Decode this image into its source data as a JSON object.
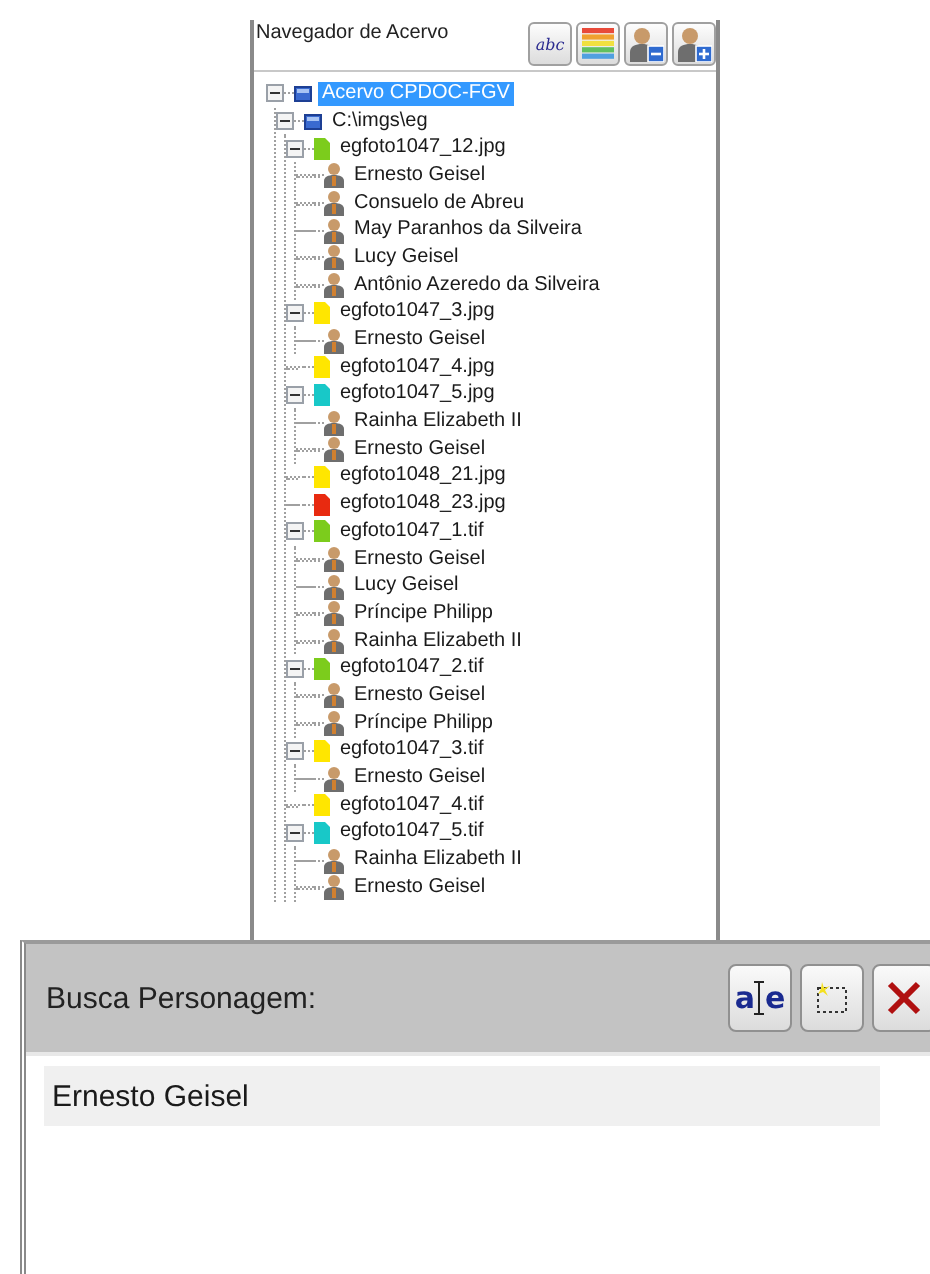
{
  "navigator": {
    "title": "Navegador de Acervo",
    "toolbar": [
      {
        "kind": "text",
        "label": "abc"
      },
      {
        "kind": "stripes"
      },
      {
        "kind": "person-minus"
      },
      {
        "kind": "person-plus"
      }
    ],
    "tree": [
      {
        "kind": "root",
        "label": "Acervo CPDOC-FGV",
        "selected": true,
        "expanded": true,
        "children": [
          {
            "kind": "folder",
            "label": "C:\\imgs\\eg",
            "selected": false,
            "expanded": true,
            "children": [
              {
                "kind": "file",
                "label": "egfoto1047_12.jpg",
                "color": "#7ccc1c",
                "selected": false,
                "expanded": true,
                "children": [
                  {
                    "kind": "person",
                    "label": "Ernesto Geisel",
                    "selected": false
                  },
                  {
                    "kind": "person",
                    "label": "Consuelo de Abreu",
                    "selected": false
                  },
                  {
                    "kind": "person",
                    "label": "May Paranhos da Silveira",
                    "selected": false
                  },
                  {
                    "kind": "person",
                    "label": "Lucy Geisel",
                    "selected": false
                  },
                  {
                    "kind": "person",
                    "label": "Antônio Azeredo da Silveira",
                    "selected": false
                  }
                ]
              },
              {
                "kind": "file",
                "label": "egfoto1047_3.jpg",
                "color": "#ffe600",
                "selected": false,
                "expanded": true,
                "children": [
                  {
                    "kind": "person",
                    "label": "Ernesto Geisel",
                    "selected": false
                  }
                ]
              },
              {
                "kind": "file",
                "label": "egfoto1047_4.jpg",
                "color": "#ffe600",
                "selected": false
              },
              {
                "kind": "file",
                "label": "egfoto1047_5.jpg",
                "color": "#18c8c8",
                "selected": false,
                "expanded": true,
                "children": [
                  {
                    "kind": "person",
                    "label": "Rainha Elizabeth II",
                    "selected": false
                  },
                  {
                    "kind": "person",
                    "label": "Ernesto Geisel",
                    "selected": false
                  }
                ]
              },
              {
                "kind": "file",
                "label": "egfoto1048_21.jpg",
                "color": "#ffe600",
                "selected": false
              },
              {
                "kind": "file",
                "label": "egfoto1048_23.jpg",
                "color": "#e82a10",
                "selected": false
              },
              {
                "kind": "file",
                "label": "egfoto1047_1.tif",
                "color": "#7ccc1c",
                "selected": false,
                "expanded": true,
                "children": [
                  {
                    "kind": "person",
                    "label": "Ernesto Geisel",
                    "selected": false
                  },
                  {
                    "kind": "person",
                    "label": "Lucy Geisel",
                    "selected": false
                  },
                  {
                    "kind": "person",
                    "label": "Príncipe Philipp",
                    "selected": false
                  },
                  {
                    "kind": "person",
                    "label": "Rainha Elizabeth II",
                    "selected": false
                  }
                ]
              },
              {
                "kind": "file",
                "label": "egfoto1047_2.tif",
                "color": "#7ccc1c",
                "selected": false,
                "expanded": true,
                "children": [
                  {
                    "kind": "person",
                    "label": "Ernesto Geisel",
                    "selected": false
                  },
                  {
                    "kind": "person",
                    "label": "Príncipe Philipp",
                    "selected": false
                  }
                ]
              },
              {
                "kind": "file",
                "label": "egfoto1047_3.tif",
                "color": "#ffe600",
                "selected": false,
                "expanded": true,
                "children": [
                  {
                    "kind": "person",
                    "label": "Ernesto Geisel",
                    "selected": false
                  }
                ]
              },
              {
                "kind": "file",
                "label": "egfoto1047_4.tif",
                "color": "#ffe600",
                "selected": false
              },
              {
                "kind": "file",
                "label": "egfoto1047_5.tif",
                "color": "#18c8c8",
                "selected": false,
                "expanded": true,
                "children": [
                  {
                    "kind": "person",
                    "label": "Rainha Elizabeth II",
                    "selected": false
                  },
                  {
                    "kind": "person",
                    "label": "Ernesto Geisel",
                    "selected": false
                  }
                ]
              }
            ]
          }
        ]
      }
    ]
  },
  "search": {
    "title": "Busca Personagem:",
    "toolbar": [
      {
        "kind": "text-cursor",
        "label_left": "a",
        "label_right": "e"
      },
      {
        "kind": "select"
      },
      {
        "kind": "delete"
      }
    ],
    "results": [
      {
        "label": "Ernesto Geisel",
        "selected": false
      }
    ]
  }
}
